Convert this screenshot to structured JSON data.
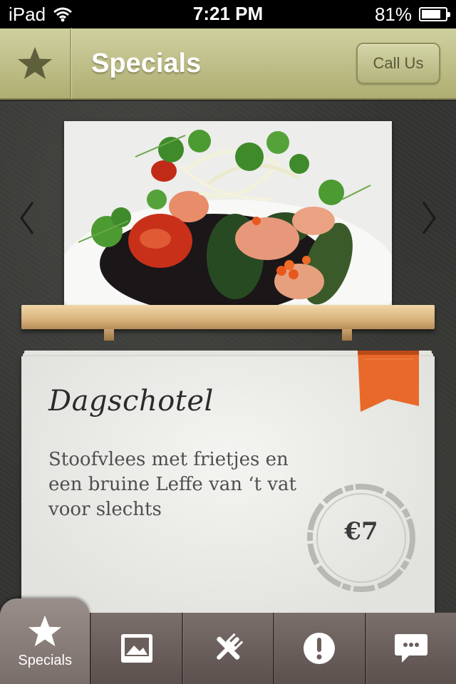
{
  "status_bar": {
    "device": "iPad",
    "time": "7:21 PM",
    "battery": "81%",
    "battery_level": 0.81
  },
  "nav": {
    "title": "Specials",
    "call_button": "Call Us",
    "icon": "star-icon"
  },
  "special": {
    "title": "Dagschotel",
    "description": "Stoofvlees met frietjes en een bruine Leffe van ‘t vat voor slechts",
    "price": "€7"
  },
  "tabs": [
    {
      "label": "Specials",
      "icon": "star-icon",
      "active": true
    },
    {
      "label": "",
      "icon": "image-icon",
      "active": false
    },
    {
      "label": "",
      "icon": "fork-knife-icon",
      "active": false
    },
    {
      "label": "",
      "icon": "info-alert-icon",
      "active": false
    },
    {
      "label": "",
      "icon": "chat-bubble-icon",
      "active": false
    }
  ],
  "colors": {
    "nav_bar": "#bcbd88",
    "tab_bar": "#6b5f5c",
    "ribbon": "#e8692a",
    "card": "#ebebe7"
  }
}
